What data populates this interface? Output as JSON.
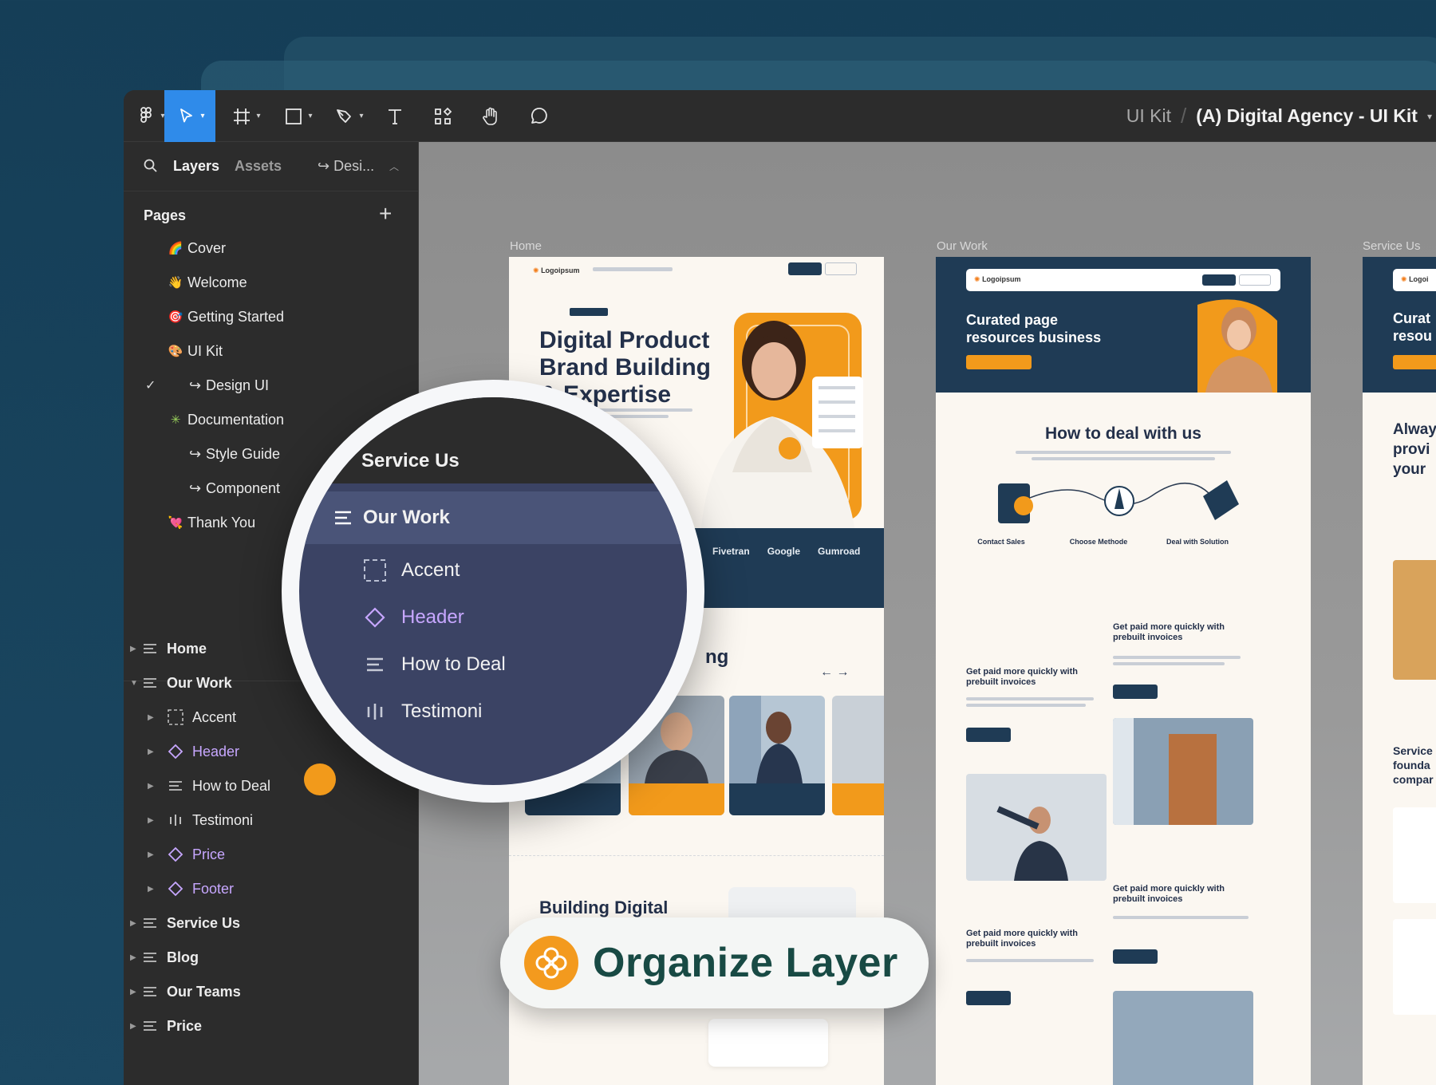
{
  "toolbar": {
    "tools": [
      "figma-menu",
      "move",
      "frame",
      "shape",
      "pen",
      "text",
      "components",
      "hand",
      "comment"
    ],
    "breadcrumb_project": "UI Kit",
    "breadcrumb_separator": "/",
    "breadcrumb_file": "(A) Digital Agency - UI Kit",
    "accent_color": "#2f8bea"
  },
  "panel": {
    "tab_layers": "Layers",
    "tab_assets": "Assets",
    "tab_design": "↪ Desi...",
    "pages_title": "Pages",
    "pages": [
      {
        "emoji": "🌈",
        "label": "Cover"
      },
      {
        "emoji": "👋",
        "label": "Welcome"
      },
      {
        "emoji": "🎯",
        "label": "Getting Started"
      },
      {
        "emoji": "🎨",
        "label": "UI Kit"
      },
      {
        "emoji": "↪",
        "label": "Design UI",
        "checked": true
      },
      {
        "emoji": "✳",
        "label": "Documentation"
      },
      {
        "emoji": "↪",
        "label": "Style Guide"
      },
      {
        "emoji": "↪",
        "label": "Component"
      },
      {
        "emoji": "💘",
        "label": "Thank You"
      }
    ],
    "layers": [
      {
        "label": "Home",
        "type": "frame",
        "depth": 0,
        "expanded": false
      },
      {
        "label": "Our Work",
        "type": "frame",
        "depth": 0,
        "expanded": true
      },
      {
        "label": "Accent",
        "type": "group",
        "depth": 1
      },
      {
        "label": "Header",
        "type": "component",
        "depth": 1
      },
      {
        "label": "How to Deal",
        "type": "frame",
        "depth": 1
      },
      {
        "label": "Testimoni",
        "type": "columns",
        "depth": 1
      },
      {
        "label": "Price",
        "type": "component",
        "depth": 1
      },
      {
        "label": "Footer",
        "type": "component",
        "depth": 1
      },
      {
        "label": "Service Us",
        "type": "frame",
        "depth": 0
      },
      {
        "label": "Blog",
        "type": "frame",
        "depth": 0
      },
      {
        "label": "Our Teams",
        "type": "frame",
        "depth": 0
      },
      {
        "label": "Price",
        "type": "frame",
        "depth": 0
      }
    ],
    "component_color": "#c7a7ff"
  },
  "canvas": {
    "frame_labels": [
      "Home",
      "Our Work",
      "Service Us"
    ],
    "home": {
      "nav_logo": "Logoipsum",
      "hero_title": "Digital Product Brand Building & Expertise",
      "brands": [
        "Fivetran",
        "Google",
        "Gumroad"
      ],
      "section_fragment": "ng",
      "arrows": "← →",
      "section_building": "Building Digital"
    },
    "our_work": {
      "nav_logo": "Logoipsum",
      "hero_title": "Curated page resources business",
      "deal_title": "How to deal with us",
      "steps": [
        "Contact Sales",
        "Choose Methode",
        "Deal with Solution"
      ],
      "invoice_title": "Get paid more quickly with prebuilt invoices"
    },
    "service_us": {
      "nav_logo": "Logoi",
      "hero_fragment": "Curat\nresou",
      "body_fragment": "Alway\nprovi\nyour",
      "service_fragment": "Service\nfounda\ncompar"
    }
  },
  "magnifier": {
    "header": "Service Us",
    "selected": "Our Work",
    "rows": [
      {
        "label": "Accent",
        "type": "group"
      },
      {
        "label": "Header",
        "type": "component"
      },
      {
        "label": "How to Deal",
        "type": "frame"
      },
      {
        "label": "Testimoni",
        "type": "columns"
      }
    ]
  },
  "badge": {
    "label": "Organize Layer",
    "color": "#f39a1e"
  }
}
